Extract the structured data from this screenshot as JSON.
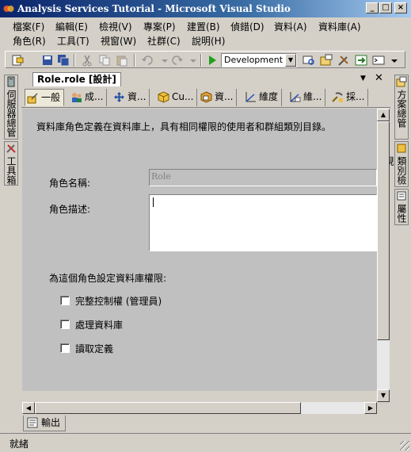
{
  "window": {
    "title": "Analysis Services Tutorial - Microsoft Visual Studio",
    "controls": [
      "_",
      "□",
      "×"
    ]
  },
  "menu": {
    "items": [
      "檔案(F)",
      "編輯(E)",
      "檢視(V)",
      "專案(P)",
      "建置(B)",
      "偵錯(D)",
      "資料(A)",
      "資料庫(A)",
      "角色(R)",
      "工具(T)",
      "視窗(W)",
      "社群(C)",
      "說明(H)"
    ]
  },
  "toolbar": {
    "configuration": "Development"
  },
  "left_sidebar": {
    "tabs": [
      "伺服器總管",
      "工具箱"
    ]
  },
  "right_sidebar": {
    "tabs": [
      "方案總管",
      "類別檢視",
      "屬性"
    ]
  },
  "document": {
    "tab_label": "Role.role [設計]",
    "pin_glyph": "▼",
    "close_glyph": "✕"
  },
  "designer_tabs": [
    {
      "label": "一般",
      "icon": "general-icon",
      "active": true
    },
    {
      "label": "成...",
      "icon": "membership-icon",
      "active": false
    },
    {
      "label": "資...",
      "icon": "data-sources-icon",
      "active": false
    },
    {
      "label": "Cu...",
      "icon": "cubes-icon",
      "active": false
    },
    {
      "label": "資...",
      "icon": "cell-data-icon",
      "active": false
    },
    {
      "label": "維度",
      "icon": "dimensions-icon",
      "active": false
    },
    {
      "label": "維...",
      "icon": "dimension-data-icon",
      "active": false
    },
    {
      "label": "採...",
      "icon": "mining-structures-icon",
      "active": false
    }
  ],
  "general_page": {
    "description": "資料庫角色定義在資料庫上，具有相同權限的使用者和群組類別目錄。",
    "role_name_label": "角色名稱:",
    "role_name_value": "Role",
    "role_description_label": "角色描述:",
    "role_description_value": "",
    "permissions_heading": "為這個角色設定資料庫權限:",
    "permissions": [
      {
        "label": "完整控制權 (管理員)",
        "checked": false
      },
      {
        "label": "處理資料庫",
        "checked": false
      },
      {
        "label": "讀取定義",
        "checked": false
      }
    ]
  },
  "bottom_tabs": {
    "output_label": "輸出"
  },
  "status": {
    "text": "就緒"
  }
}
